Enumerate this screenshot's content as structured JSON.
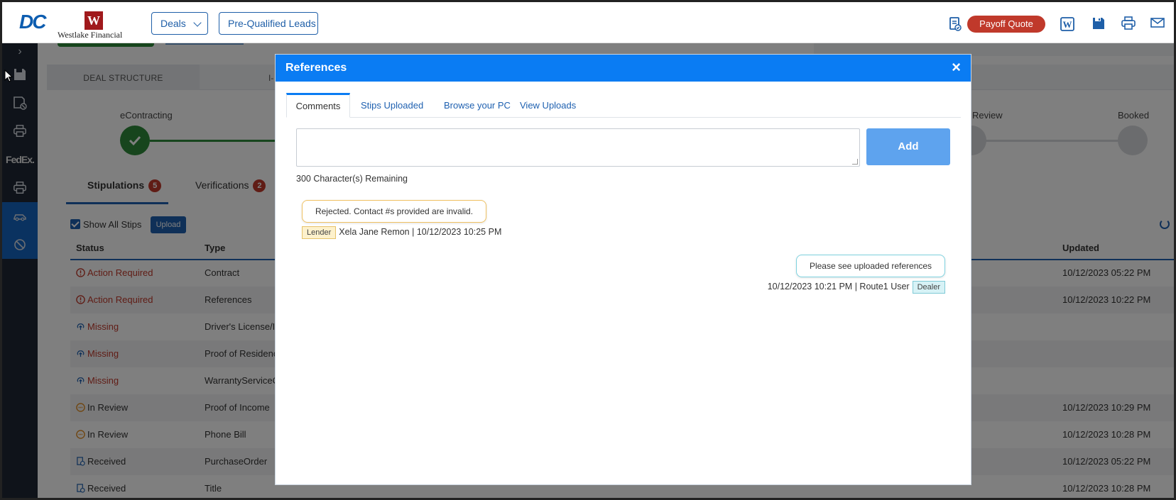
{
  "header": {
    "logo_dc": "DC",
    "logo_w": "W",
    "logo_text": "Westlake Financial",
    "nav_deals": "Deals",
    "nav_leads": "Pre-Qualified Leads",
    "payoff_label": "Payoff Quote",
    "icons": [
      "document-check-icon",
      "word-icon",
      "save-icon",
      "print-icon",
      "mail-icon"
    ]
  },
  "sidebar": {
    "expand_glyph": "›",
    "fedex_label": "FedEx.",
    "items": [
      "save-icon",
      "save-cancel-icon",
      "print-icon",
      "fedex-logo",
      "print-icon",
      "car-icon",
      "no-access-icon"
    ]
  },
  "background": {
    "tabs": [
      "DEAL STRUCTURE",
      "I-"
    ],
    "steps": [
      "eContracting",
      "Review",
      "Booked"
    ],
    "stip_tab": "Stipulations",
    "stip_count": "5",
    "verif_tab": "Verifications",
    "verif_count": "2",
    "show_all": "Show All Stips",
    "upload": "Upload",
    "columns": {
      "status": "Status",
      "type": "Type",
      "updated": "Updated"
    },
    "rows": [
      {
        "status": "Action Required",
        "type": "Contract",
        "updated": "10/12/2023 05:22 PM"
      },
      {
        "status": "Action Required",
        "type": "References",
        "updated": "10/12/2023 10:22 PM"
      },
      {
        "status": "Missing",
        "type": "Driver's License/Id",
        "updated": ""
      },
      {
        "status": "Missing",
        "type": "Proof of Residence",
        "updated": ""
      },
      {
        "status": "Missing",
        "type": "WarrantyServiceCo",
        "updated": ""
      },
      {
        "status": "In Review",
        "type": "Proof of Income",
        "updated": "10/12/2023 10:29 PM"
      },
      {
        "status": "In Review",
        "type": "Phone Bill",
        "updated": "10/12/2023 10:28 PM"
      },
      {
        "status": "Received",
        "type": "PurchaseOrder",
        "updated": "10/12/2023 05:22 PM"
      },
      {
        "status": "Received",
        "type": "Title",
        "updated": "10/12/2023 10:28 PM"
      }
    ]
  },
  "modal": {
    "title": "References",
    "close": "×",
    "tabs": [
      "Comments",
      "Stips Uploaded",
      "Browse your PC",
      "View Uploads"
    ],
    "add_label": "Add",
    "remaining": "300 Character(s) Remaining",
    "comments": [
      {
        "text": "Rejected. Contact #s provided are invalid.",
        "tag": "Lender",
        "meta": "Xela Jane Remon | 10/12/2023 10:25 PM"
      },
      {
        "text": "Please see uploaded references",
        "tag": "Dealer",
        "meta": "10/12/2023 10:21 PM | Route1 User"
      }
    ]
  },
  "colors": {
    "modal_header": "#0a7cf3",
    "payoff": "#c0392b",
    "sidebar": "#1e2734",
    "step_done": "#2e8b3a",
    "add_button": "#5ea3ee"
  }
}
